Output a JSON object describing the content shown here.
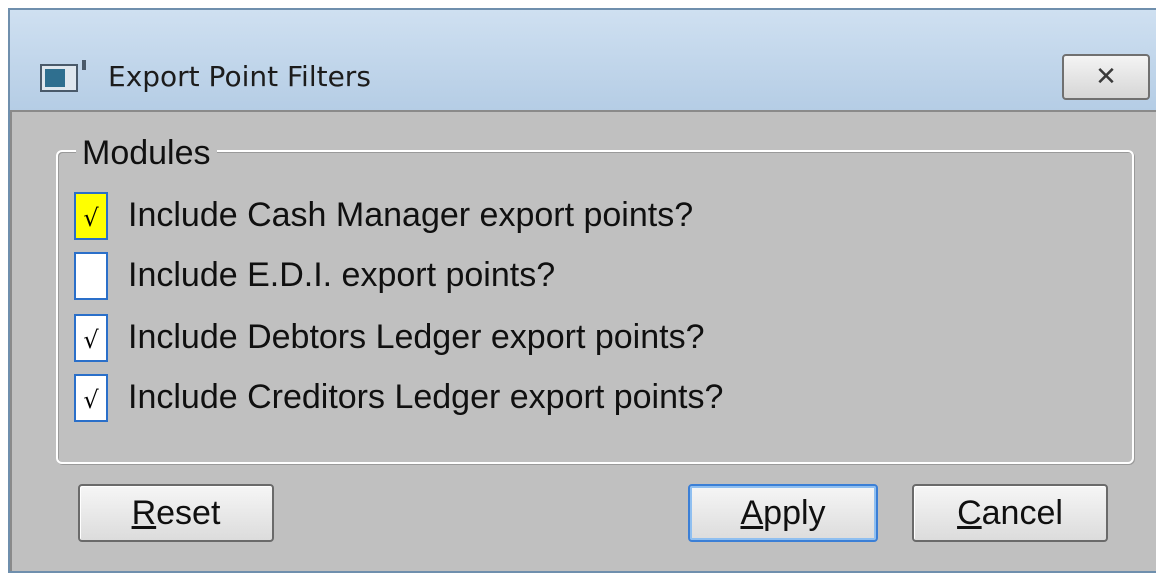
{
  "window": {
    "title": "Export Point Filters",
    "close_glyph": "✕"
  },
  "modules": {
    "group_label": "Modules",
    "options": [
      {
        "label": "Include Cash Manager export points?",
        "checked": true,
        "focused": true
      },
      {
        "label": "Include E.D.I. export points?",
        "checked": false,
        "focused": false
      },
      {
        "label": "Include Debtors Ledger export points?",
        "checked": true,
        "focused": false
      },
      {
        "label": "Include Creditors Ledger export points?",
        "checked": true,
        "focused": false
      }
    ]
  },
  "buttons": {
    "reset": {
      "mnemonic": "R",
      "rest": "eset"
    },
    "apply": {
      "mnemonic": "A",
      "rest": "pply"
    },
    "cancel": {
      "mnemonic": "C",
      "rest": "ancel"
    }
  },
  "check_glyph": "√",
  "colors": {
    "focus_highlight": "#ffff00",
    "checkbox_border": "#2a6fc9",
    "dialog_bg": "#c0c0c0"
  }
}
